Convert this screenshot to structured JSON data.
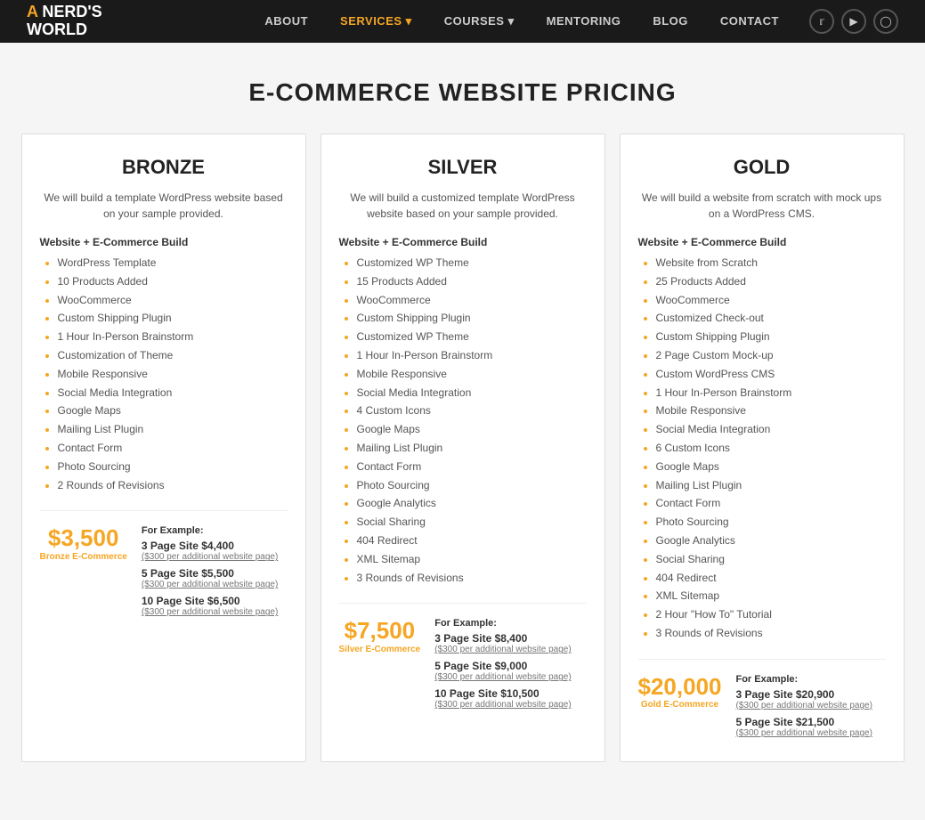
{
  "nav": {
    "logo_line1": "A NERD'S",
    "logo_line2": "WORLD",
    "links": [
      {
        "label": "ABOUT",
        "active": false
      },
      {
        "label": "SERVICES",
        "active": true,
        "has_dropdown": true
      },
      {
        "label": "COURSES",
        "active": false,
        "has_dropdown": true
      },
      {
        "label": "MENTORING",
        "active": false
      },
      {
        "label": "BLOG",
        "active": false
      },
      {
        "label": "CONTACT",
        "active": false
      }
    ],
    "icons": [
      "twitter",
      "youtube",
      "instagram"
    ]
  },
  "page": {
    "title": "E-COMMERCE WEBSITE PRICING"
  },
  "plans": [
    {
      "id": "bronze",
      "title": "BRONZE",
      "description_parts": [
        "We will build a template WordPress website based on your sample provided."
      ],
      "section_label": "Website + E-Commerce Build",
      "features": [
        "WordPress Template",
        "10 Products Added",
        "WooCommerce",
        "Custom Shipping Plugin",
        "1 Hour In-Person Brainstorm",
        "Customization of Theme",
        "Mobile Responsive",
        "Social Media Integration",
        "Google Maps",
        "Mailing List Plugin",
        "Contact Form",
        "Photo Sourcing",
        "2 Rounds of Revisions"
      ],
      "big_price": "$3,500",
      "price_label": "Bronze E-Commerce",
      "for_example_label": "For Example:",
      "price_tiers": [
        {
          "row": "3 Page Site $4,400",
          "sub": "($300 per additional website page)"
        },
        {
          "row": "5 Page Site $5,500",
          "sub": "($300 per additional website page)"
        },
        {
          "row": "10 Page Site $6,500",
          "sub": "($300 per additional website page)"
        }
      ]
    },
    {
      "id": "silver",
      "title": "SILVER",
      "description_parts": [
        "We will build a customized template WordPress website based on your sample provided."
      ],
      "section_label": "Website + E-Commerce Build",
      "features": [
        "Customized WP Theme",
        "15 Products Added",
        "WooCommerce",
        "Custom Shipping Plugin",
        "Customized WP Theme",
        "1 Hour In-Person Brainstorm",
        "Mobile Responsive",
        "Social Media Integration",
        "4 Custom Icons",
        "Google Maps",
        "Mailing List Plugin",
        "Contact Form",
        "Photo Sourcing",
        "Google Analytics",
        "Social Sharing",
        "404 Redirect",
        "XML Sitemap",
        "3 Rounds of Revisions"
      ],
      "big_price": "$7,500",
      "price_label": "Silver E-Commerce",
      "for_example_label": "For Example:",
      "price_tiers": [
        {
          "row": "3 Page Site $8,400",
          "sub": "($300 per additional website page)"
        },
        {
          "row": "5 Page Site $9,000",
          "sub": "($300 per additional website page)"
        },
        {
          "row": "10 Page Site $10,500",
          "sub": "($300 per additional website page)"
        }
      ]
    },
    {
      "id": "gold",
      "title": "GOLD",
      "description_parts": [
        "We will build a website from scratch with mock ups on a WordPress CMS."
      ],
      "section_label": "Website + E-Commerce Build",
      "features": [
        "Website from Scratch",
        "25 Products Added",
        "WooCommerce",
        "Customized Check-out",
        "Custom Shipping Plugin",
        "2 Page Custom Mock-up",
        "Custom WordPress CMS",
        "1 Hour In-Person Brainstorm",
        "Mobile Responsive",
        "Social Media Integration",
        "6 Custom Icons",
        "Google Maps",
        "Mailing List Plugin",
        "Contact Form",
        "Photo Sourcing",
        "Google Analytics",
        "Social Sharing",
        "404 Redirect",
        "XML Sitemap",
        "2 Hour \"How To\" Tutorial",
        "3 Rounds of Revisions"
      ],
      "big_price": "$20,000",
      "price_label": "Gold E-Commerce",
      "for_example_label": "For Example:",
      "price_tiers": [
        {
          "row": "3 Page Site $20,900",
          "sub": "($300 per additional website page)"
        },
        {
          "row": "5 Page Site $21,500",
          "sub": "($300 per additional website page)"
        }
      ]
    }
  ]
}
